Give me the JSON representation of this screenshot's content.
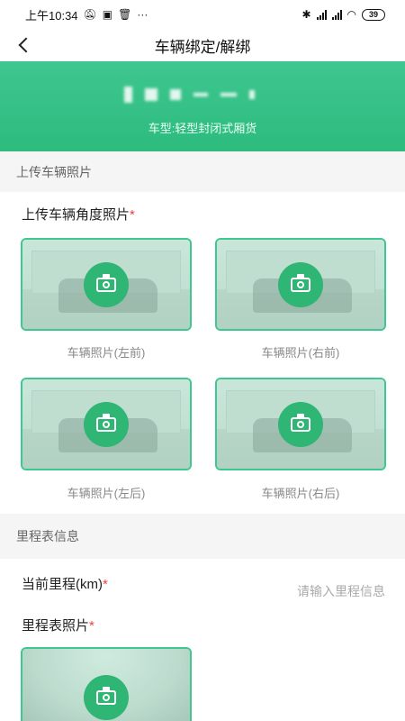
{
  "status_bar": {
    "time": "上午10:34",
    "icons_left": [
      "mute-icon",
      "message-icon",
      "trash-icon",
      "more-icon"
    ],
    "icons_right": [
      "bluetooth-icon",
      "signal-hd-icon",
      "signal-hd-icon",
      "wifi-icon"
    ],
    "signal_label": "HD",
    "battery": "39"
  },
  "nav": {
    "title": "车辆绑定/解绑"
  },
  "header": {
    "vehicle_type": "车型:轻型封闭式厢货"
  },
  "upload_section": {
    "title": "上传车辆照片",
    "angle_label": "上传车辆角度照片",
    "required_mark": "*",
    "photos": [
      {
        "caption": "车辆照片(左前)"
      },
      {
        "caption": "车辆照片(右前)"
      },
      {
        "caption": "车辆照片(左后)"
      },
      {
        "caption": "车辆照片(右后)"
      }
    ]
  },
  "odometer_section": {
    "title": "里程表信息",
    "mileage_label": "当前里程(km)",
    "mileage_placeholder": "请输入里程信息",
    "mileage_value": "",
    "photo_label": "里程表照片",
    "required_mark": "*"
  },
  "colors": {
    "accent": "#2fb574",
    "banner": "#3ec790",
    "required": "#e64343"
  }
}
